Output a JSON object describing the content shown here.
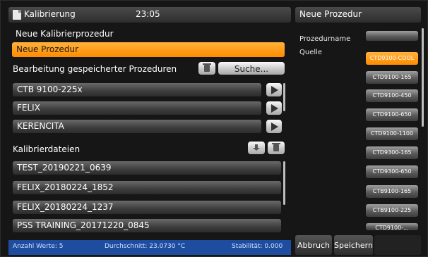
{
  "header": {
    "title": "Kalibrierung",
    "time": "23:05",
    "doc_icon": "document-icon"
  },
  "new_procedure": {
    "label": "Neue Kalibrierprozedur",
    "value": "Neue Prozedur"
  },
  "saved_procedures": {
    "label": "Bearbeitung gespeicherter Prozeduren",
    "delete_icon": "trash-icon",
    "search_label": "Suche...",
    "items": [
      {
        "label": "CTB 9100-225x"
      },
      {
        "label": "FELIX"
      },
      {
        "label": "KERENCITA"
      }
    ],
    "play_icon": "play-icon"
  },
  "files": {
    "label": "Kalibrierdateien",
    "download_icon": "download-icon",
    "delete_icon": "trash-icon",
    "items": [
      {
        "label": "TEST_20190221_0639"
      },
      {
        "label": "FELIX_20180224_1852"
      },
      {
        "label": "FELIX_20180224_1237"
      },
      {
        "label": "PSS TRAINING_20171220_0845"
      }
    ]
  },
  "status": {
    "count": "Anzahl Werte: 5",
    "average": "Durchschnitt: 23.0730 °C",
    "stability": "Stabilität: 0.000"
  },
  "right_panel": {
    "title": "Neue Prozedur",
    "name_label": "Prozedurname",
    "name_value": "",
    "source_label": "Quelle",
    "sources": [
      {
        "label": "CTD9100-COOL",
        "active": true
      },
      {
        "label": "CTD9100-165",
        "active": false
      },
      {
        "label": "CTD9100-450",
        "active": false
      },
      {
        "label": "CTD9100-650",
        "active": false
      },
      {
        "label": "CTD9100-1100",
        "active": false
      },
      {
        "label": "CTD9300-165",
        "active": false
      },
      {
        "label": "CTD9300-650",
        "active": false
      },
      {
        "label": "CTB9100-165",
        "active": false
      },
      {
        "label": "CTB9100-225",
        "active": false
      },
      {
        "label": "CTD9100-...",
        "active": false
      }
    ],
    "cancel_label": "Abbruch",
    "save_label": "Speichern"
  },
  "colors": {
    "accent": "#ff9a1f",
    "status_bar": "#1e4da0",
    "background": "#161616"
  }
}
